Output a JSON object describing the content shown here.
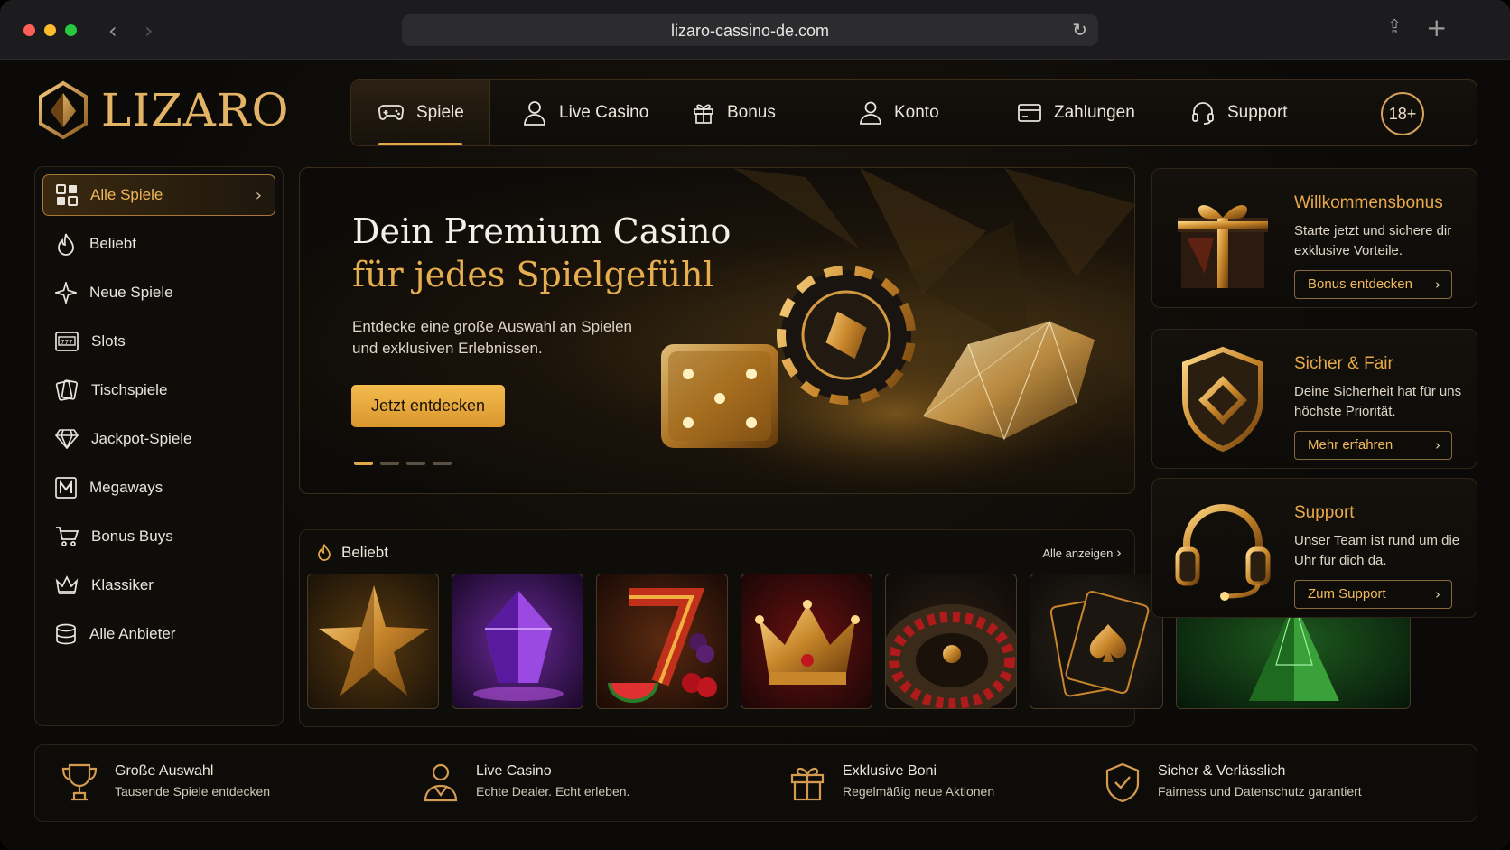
{
  "browser": {
    "url": "lizaro-cassino-de.com"
  },
  "brand": {
    "name": "LIZARO",
    "accent": "#e4a84a"
  },
  "topnav": {
    "items": [
      {
        "label": "Spiele",
        "icon": "gamepad-icon"
      },
      {
        "label": "Live Casino",
        "icon": "user-icon"
      },
      {
        "label": "Bonus",
        "icon": "gift-icon"
      },
      {
        "label": "Konto",
        "icon": "account-icon"
      },
      {
        "label": "Zahlungen",
        "icon": "card-icon"
      },
      {
        "label": "Support",
        "icon": "headset-icon"
      }
    ],
    "age_badge": "18+"
  },
  "sidebar": {
    "items": [
      {
        "label": "Alle Spiele",
        "icon": "grid-icon"
      },
      {
        "label": "Beliebt",
        "icon": "flame-icon"
      },
      {
        "label": "Neue Spiele",
        "icon": "sparkle-icon"
      },
      {
        "label": "Slots",
        "icon": "slot-machine-icon"
      },
      {
        "label": "Tischspiele",
        "icon": "cards-icon"
      },
      {
        "label": "Jackpot-Spiele",
        "icon": "diamond-icon"
      },
      {
        "label": "Megaways",
        "icon": "m-icon"
      },
      {
        "label": "Bonus Buys",
        "icon": "cart-icon"
      },
      {
        "label": "Klassiker",
        "icon": "crown-icon"
      },
      {
        "label": "Alle Anbieter",
        "icon": "stack-icon"
      }
    ]
  },
  "hero": {
    "title_line1": "Dein Premium Casino",
    "title_line2": "für jedes Spielgefühl",
    "text": "Entdecke eine große Auswahl an Spielen und exklusiven Erlebnissen.",
    "cta": "Jetzt entdecken",
    "slides": 4,
    "active_slide": 1
  },
  "popular": {
    "title": "Beliebt",
    "all_link": "Alle anzeigen",
    "tiles": [
      "star-tile",
      "amethyst-tile",
      "seven-fruits-tile",
      "crown-tile",
      "roulette-tile",
      "ace-cards-tile",
      "emerald-tile"
    ]
  },
  "cards": [
    {
      "title": "Willkommensbonus",
      "text": "Starte jetzt und sichere dir exklusive Vorteile.",
      "button": "Bonus entdecken",
      "icon": "gift-box-icon"
    },
    {
      "title": "Sicher & Fair",
      "text": "Deine Sicherheit hat für uns höchste Priorität.",
      "button": "Mehr erfahren",
      "icon": "shield-icon"
    },
    {
      "title": "Support",
      "text": "Unser Team ist rund um die Uhr für dich da.",
      "button": "Zum Support",
      "icon": "headset-icon"
    }
  ],
  "features": [
    {
      "title": "Große Auswahl",
      "sub": "Tausende Spiele entdecken",
      "icon": "trophy-icon"
    },
    {
      "title": "Live Casino",
      "sub": "Echte Dealer. Echt erleben.",
      "icon": "dealer-icon"
    },
    {
      "title": "Exklusive Boni",
      "sub": "Regelmäßig neue Aktionen",
      "icon": "gift-icon"
    },
    {
      "title": "Sicher & Verlässlich",
      "sub": "Fairness und Datenschutz garantiert",
      "icon": "shield-check-icon"
    }
  ]
}
